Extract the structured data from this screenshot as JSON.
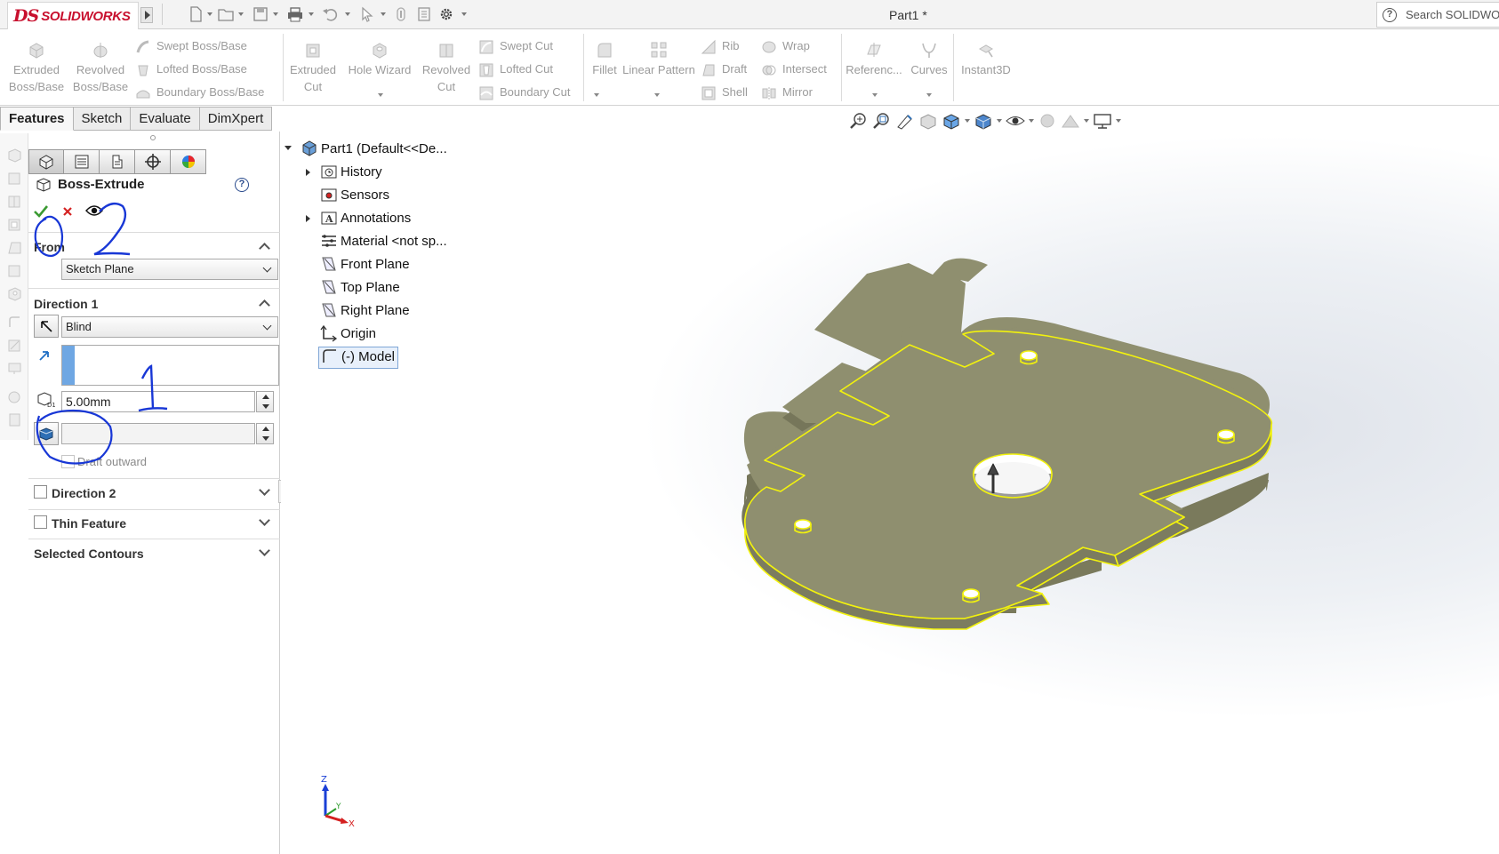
{
  "app": {
    "brand_ds": "DS",
    "brand_name": "SOLIDWORKS",
    "doc_title": "Part1 *",
    "search_placeholder": "Search SOLIDWORKS"
  },
  "ribbon": {
    "extruded_boss": "Extruded Boss/Base",
    "revolved_boss": "Revolved Boss/Base",
    "swept_boss": "Swept Boss/Base",
    "lofted_boss": "Lofted Boss/Base",
    "boundary_boss": "Boundary Boss/Base",
    "extruded_cut": "Extruded Cut",
    "hole_wizard": "Hole Wizard",
    "revolved_cut": "Revolved Cut",
    "swept_cut": "Swept Cut",
    "lofted_cut": "Lofted Cut",
    "boundary_cut": "Boundary Cut",
    "fillet": "Fillet",
    "linear_pattern": "Linear Pattern",
    "rib": "Rib",
    "draft": "Draft",
    "shell": "Shell",
    "wrap": "Wrap",
    "intersect": "Intersect",
    "mirror": "Mirror",
    "reference": "Referenc...",
    "curves": "Curves",
    "instant3d": "Instant3D"
  },
  "tabs": [
    "Features",
    "Sketch",
    "Evaluate",
    "DimXpert"
  ],
  "property_manager": {
    "title": "Boss-Extrude",
    "help": "?",
    "from_label": "From",
    "from_value": "Sketch Plane",
    "direction1_label": "Direction 1",
    "end_condition": "Blind",
    "depth_value": "5.00mm",
    "draft_outward": "Draft outward",
    "direction2_label": "Direction 2",
    "thin_feature_label": "Thin Feature",
    "selected_contours_label": "Selected Contours"
  },
  "tree": {
    "root": "Part1  (Default<<De...",
    "items": [
      "History",
      "Sensors",
      "Annotations",
      "Material <not sp...",
      "Front Plane",
      "Top Plane",
      "Right Plane",
      "Origin",
      "(-) Model"
    ]
  },
  "triad": {
    "z": "Z",
    "y": "Y",
    "x": "X"
  },
  "colors": {
    "brand_red": "#c8102e",
    "model_fill": "#8f8f6f",
    "model_edge": "#f2f20d",
    "annotation_blue": "#1837d6"
  }
}
